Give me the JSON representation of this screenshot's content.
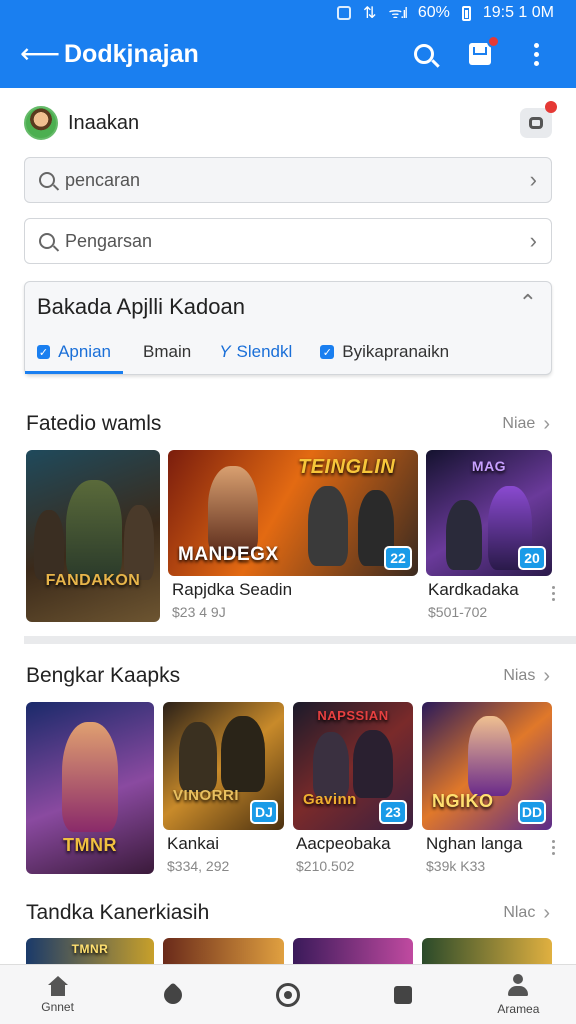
{
  "status_bar": {
    "battery": "60%",
    "time": "19:5 1 0M"
  },
  "app_bar": {
    "title": "Dodkjnajan"
  },
  "user": {
    "name": "Inaakan"
  },
  "search_fields": [
    {
      "placeholder": "pencaran"
    },
    {
      "placeholder": "Pengarsan"
    }
  ],
  "category_card": {
    "title": "Bakada Apjlli Kadoan",
    "tabs": [
      {
        "label": "Apnian",
        "icon": "check-icon",
        "active": true
      },
      {
        "label": "Bmain",
        "icon": "",
        "active": false
      },
      {
        "label": "Slendkl",
        "icon": "slash-icon",
        "prefix": "Y",
        "active": false
      },
      {
        "label": "Byikapranaikn",
        "icon": "check-icon",
        "active": false
      }
    ]
  },
  "section_featured": {
    "title": "Fatedio wamls",
    "more": "Niae",
    "tiles": [
      {
        "caption": "FANDAKON",
        "badge": "",
        "colors": [
          "#3b2a1a",
          "#6d5531",
          "#1f4a5c"
        ]
      },
      {
        "caption": "MANDEGX",
        "headline": "TEINGLIN",
        "badge": "22",
        "name": "Rapjdka Seadin",
        "price": "$23 4 9J",
        "colors": [
          "#7a1d0d",
          "#e36a12",
          "#3a2a20"
        ]
      },
      {
        "caption": "",
        "headline": "MAG",
        "badge": "20",
        "name": "Kardkadaka",
        "price": "$501-702",
        "colors": [
          "#2a1a4a",
          "#6a3a9a",
          "#14122e"
        ]
      }
    ]
  },
  "section_second": {
    "title": "Bengkar Kaapks",
    "more": "Nias",
    "tiles": [
      {
        "caption": "TMNR",
        "badge": "",
        "name": "",
        "price": "",
        "colors": [
          "#1a2a6a",
          "#8a4aa0",
          "#3a1a3a"
        ]
      },
      {
        "caption": "VINORRI",
        "badge": "DJ",
        "name": "Kankai",
        "price": "$334, 292",
        "colors": [
          "#4a3010",
          "#c88a2a",
          "#2a2018"
        ]
      },
      {
        "caption": "Gavinn",
        "headline": "NAPSSIAN",
        "badge": "23",
        "name": "Aacpeobaka",
        "price": "$210.502",
        "colors": [
          "#3a2040",
          "#7a2a2a",
          "#1a1a2a"
        ]
      },
      {
        "caption": "NGIKO",
        "badge": "DD",
        "name": "Nghan langa",
        "price": "$39k K33",
        "colors": [
          "#2a1a5a",
          "#e0782a",
          "#5a2a8a"
        ]
      }
    ]
  },
  "section_third": {
    "title": "Tandka Kanerkiasih",
    "more": "Nlac",
    "tiles": [
      {
        "caption": "TMNR",
        "colors": [
          "#1a3a6a",
          "#c8a02a"
        ]
      },
      {
        "caption": "",
        "colors": [
          "#6a2a1a",
          "#e0a040"
        ]
      },
      {
        "caption": "",
        "colors": [
          "#3a1a5a",
          "#c04aa0"
        ]
      },
      {
        "caption": "",
        "colors": [
          "#2a4a2a",
          "#e0b040"
        ]
      }
    ]
  },
  "bottom_nav": [
    {
      "label": "Gnnet",
      "icon": "home-icon"
    },
    {
      "label": "",
      "icon": "tag-icon"
    },
    {
      "label": "",
      "icon": "discover-icon"
    },
    {
      "label": "",
      "icon": "square-icon"
    },
    {
      "label": "Aramea",
      "icon": "profile-icon"
    }
  ],
  "colors": {
    "primary": "#1a7ff0",
    "notification": "#e53935",
    "badge": "#1a9be8"
  }
}
